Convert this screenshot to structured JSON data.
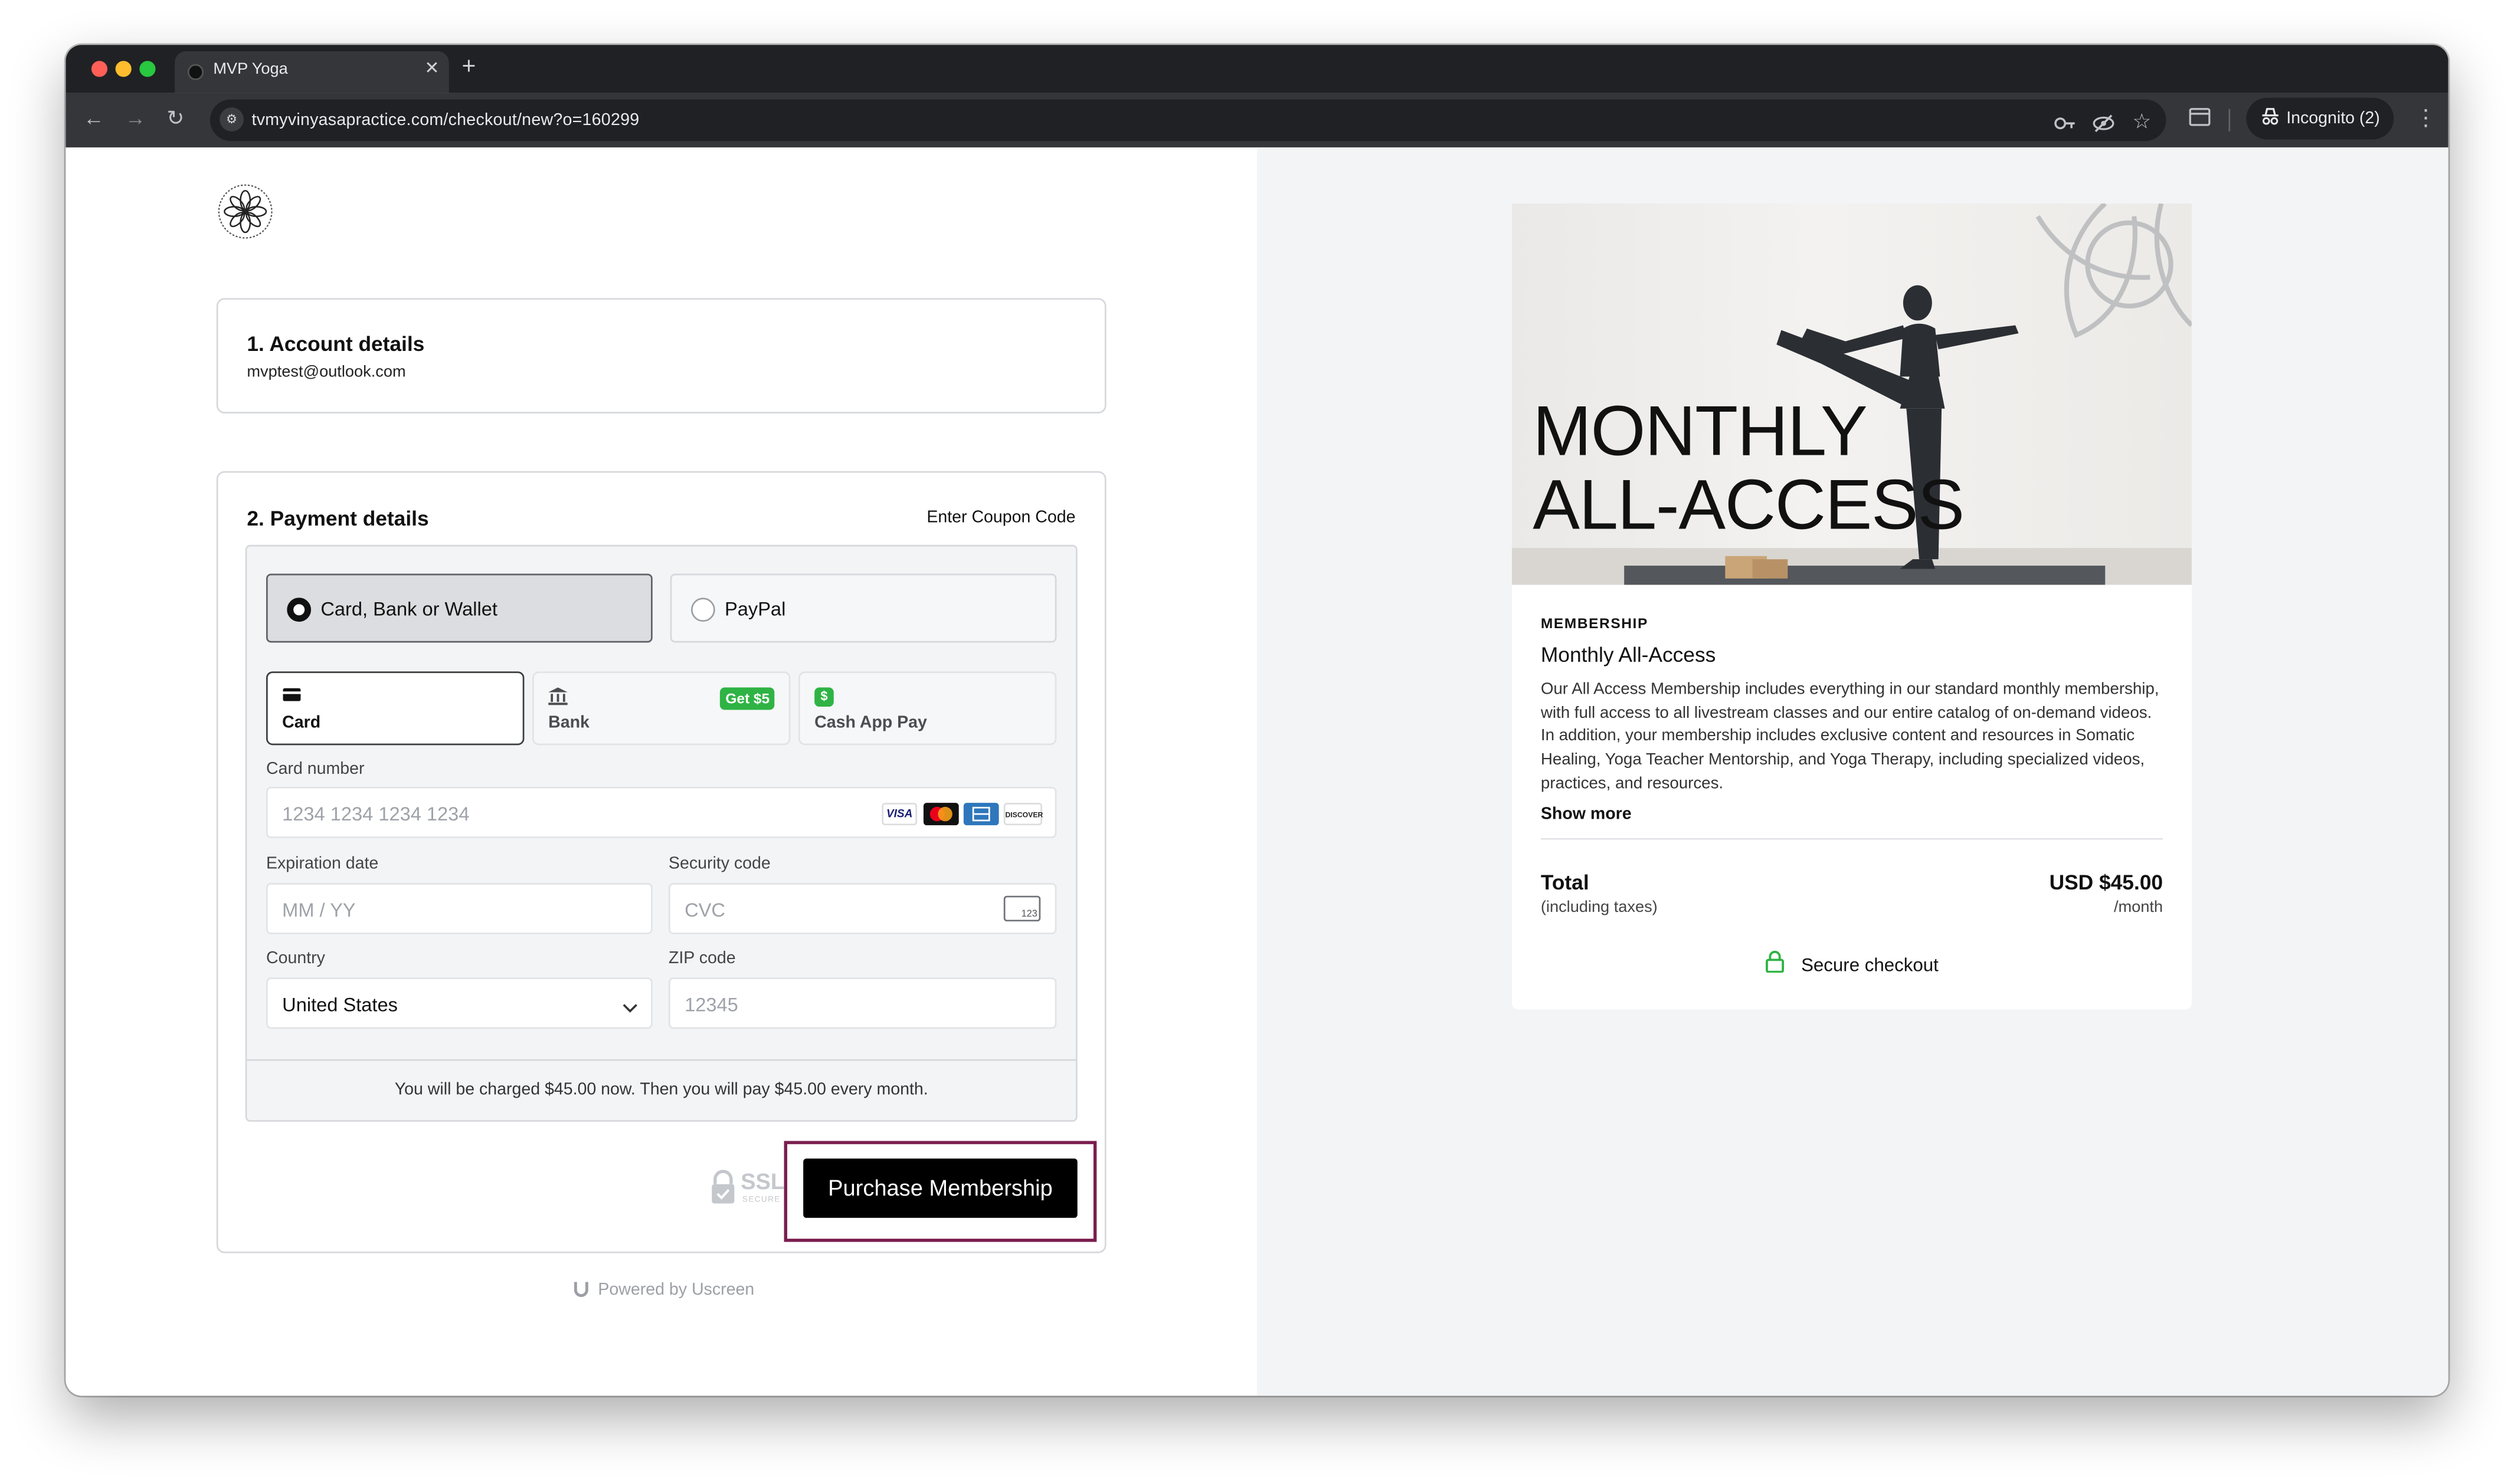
{
  "browser": {
    "tab_title": "MVP Yoga",
    "url": "tvmyvinyasapractice.com/checkout/new?o=160299",
    "profile_label": "Incognito (2)",
    "icons": [
      "back-icon",
      "forward-icon",
      "reload-icon",
      "site-info-icon",
      "password-key-icon",
      "eye-off-icon",
      "bookmark-star-icon",
      "tab-search-icon",
      "incognito-icon",
      "menu-kebab-icon"
    ]
  },
  "account": {
    "heading": "1. Account details",
    "email": "mvptest@outlook.com"
  },
  "payment": {
    "heading": "2. Payment details",
    "coupon_link": "Enter Coupon Code",
    "methods": [
      {
        "label": "Card, Bank or Wallet",
        "selected": true
      },
      {
        "label": "PayPal",
        "selected": false
      }
    ],
    "sub_tabs": [
      {
        "label": "Card",
        "selected": true
      },
      {
        "label": "Bank",
        "badge": "Get $5"
      },
      {
        "label": "Cash App Pay",
        "icon_glyph": "$"
      }
    ],
    "card_number": {
      "label": "Card number",
      "placeholder": "1234 1234 1234 1234"
    },
    "card_brands": [
      "VISA",
      "mastercard",
      "amex",
      "DISCOVER"
    ],
    "expiration": {
      "label": "Expiration date",
      "placeholder": "MM / YY"
    },
    "security": {
      "label": "Security code",
      "placeholder": "CVC",
      "icon_text": "123"
    },
    "country": {
      "label": "Country",
      "value": "United States"
    },
    "zip": {
      "label": "ZIP code",
      "placeholder": "12345"
    },
    "charge_note": "You will be charged $45.00 now. Then you will pay $45.00 every month.",
    "ssl_text": "SSL",
    "ssl_sub": "SECURE",
    "purchase_button": "Purchase Membership"
  },
  "footer": {
    "powered_by": "Powered by Uscreen"
  },
  "product": {
    "hero_title_line1": "MONTHLY",
    "hero_title_line2": "ALL-ACCESS",
    "eyebrow": "MEMBERSHIP",
    "name": "Monthly All-Access",
    "description": "Our All Access Membership includes everything in our standard monthly membership, with full access to all livestream classes and our entire catalog of on-demand videos. In addition, your membership includes exclusive content and resources in Somatic Healing, Yoga Teacher Mentorship, and Yoga Therapy, including specialized videos, practices, and resources.",
    "show_more": "Show more",
    "total_label": "Total",
    "total_sub": "(including taxes)",
    "price": "USD $45.00",
    "period": "/month",
    "secure_checkout": "Secure checkout"
  }
}
